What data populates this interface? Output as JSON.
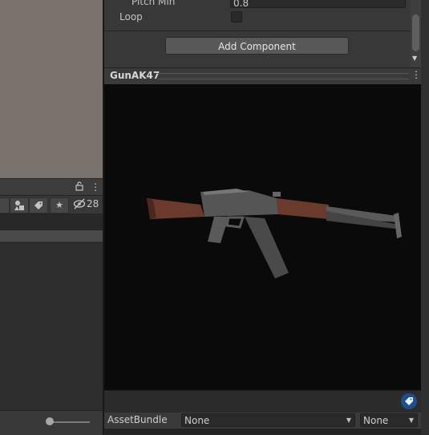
{
  "inspector": {
    "pitch_min_label": "Pitch Min",
    "pitch_min_value": "0.8",
    "loop_label": "Loop",
    "loop_checked": false,
    "add_component_label": "Add Component"
  },
  "project": {
    "hidden_count": "28"
  },
  "preview": {
    "title": "GunAK47"
  },
  "asset_bundle": {
    "label": "AssetBundle",
    "name_value": "None",
    "variant_value": "None"
  },
  "colors": {
    "scene_background": "#7a736d",
    "preview_background": "#0a0a0a",
    "label_badge": "#1f4f8a"
  },
  "icons": [
    "lock-icon",
    "kebab-menu-icon",
    "filter-by-type-icon",
    "filter-by-label-icon",
    "favorites-star-icon",
    "hidden-eye-icon",
    "label-tag-icon",
    "dropdown-caret-icon",
    "scroll-down-arrow-icon"
  ]
}
